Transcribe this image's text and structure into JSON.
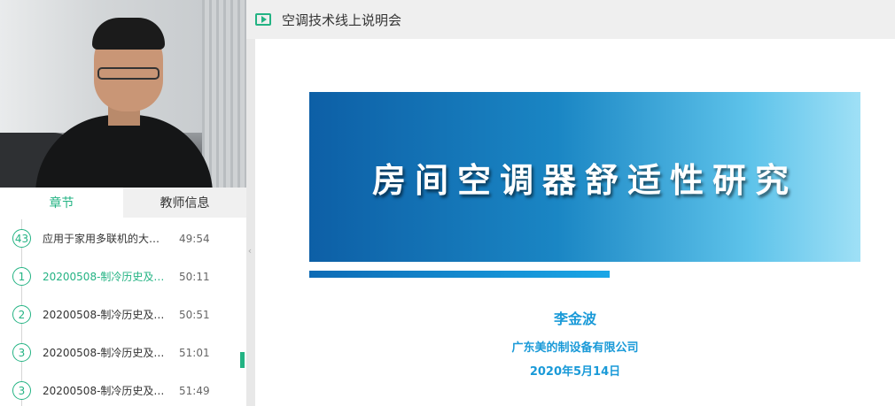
{
  "header": {
    "title": "空调技术线上说明会"
  },
  "tabs": [
    {
      "label": "章节",
      "active": true
    },
    {
      "label": "教师信息",
      "active": false
    }
  ],
  "chapters": [
    {
      "num": "43",
      "title": "应用于家用多联机的大小...",
      "duration": "49:54",
      "active": false
    },
    {
      "num": "1",
      "title": "20200508-制冷历史及房...",
      "duration": "50:11",
      "active": true
    },
    {
      "num": "2",
      "title": "20200508-制冷历史及房...",
      "duration": "50:51",
      "active": false
    },
    {
      "num": "3",
      "title": "20200508-制冷历史及房...",
      "duration": "51:01",
      "active": false
    },
    {
      "num": "3",
      "title": "20200508-制冷历史及房...",
      "duration": "51:49",
      "active": false
    }
  ],
  "slide": {
    "title": "房间空调器舒适性研究",
    "author": "李金波",
    "company": "广东美的制设备有限公司",
    "date": "2020年5月14日"
  },
  "colors": {
    "accent": "#23b383",
    "slide_text": "#1a9ad8"
  },
  "icons": {
    "header": "play-icon",
    "collapse": "chevron-left-icon"
  }
}
